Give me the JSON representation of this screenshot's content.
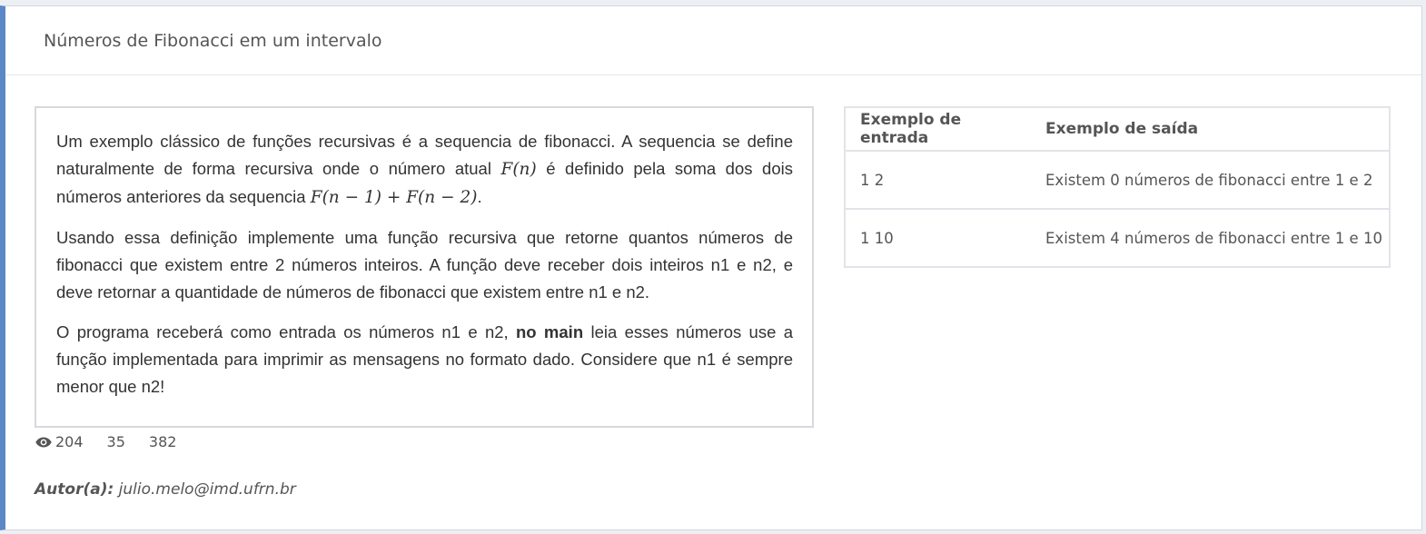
{
  "header": {
    "title": "Números de Fibonacci em um intervalo"
  },
  "statement": {
    "p1_text_a": "Um exemplo clássico de funções recursivas é a sequencia de fibonacci. A sequencia se define naturalmente de forma recursiva onde o número atual ",
    "p1_math_a": "F(n)",
    "p1_text_b": " é definido pela soma dos dois números anteriores da sequencia ",
    "p1_math_b": "F(n − 1) + F(n − 2)",
    "p1_text_c": ".",
    "p2": "Usando essa definição implemente uma função recursiva que retorne quantos números de fibonacci que existem entre 2 números inteiros. A função deve receber dois inteiros n1 e n2, e deve retornar a quantidade de números de fibonacci que existem entre n1 e n2.",
    "p3_text_a": "O programa receberá como entrada os números n1 e n2, ",
    "p3_bold": "no main",
    "p3_text_b": " leia esses números use a função implementada para imprimir as mensagens no formato dado. Considere que n1 é sempre menor que n2!"
  },
  "stats": {
    "views": "204",
    "second": "35",
    "third": "382",
    "icon": "eye-icon"
  },
  "author": {
    "label": "Autor(a):",
    "email": "julio.melo@imd.ufrn.br"
  },
  "examples": {
    "headers": [
      "Exemplo de entrada",
      "Exemplo de saída"
    ],
    "rows": [
      {
        "input": "1 2",
        "output": "Existem 0 números de fibonacci entre 1 e 2"
      },
      {
        "input": "1 10",
        "output": "Existem 4 números de fibonacci entre 1 e 10"
      }
    ]
  },
  "colors": {
    "accent_border": "#5b87c7",
    "background": "#ecf0f5"
  }
}
